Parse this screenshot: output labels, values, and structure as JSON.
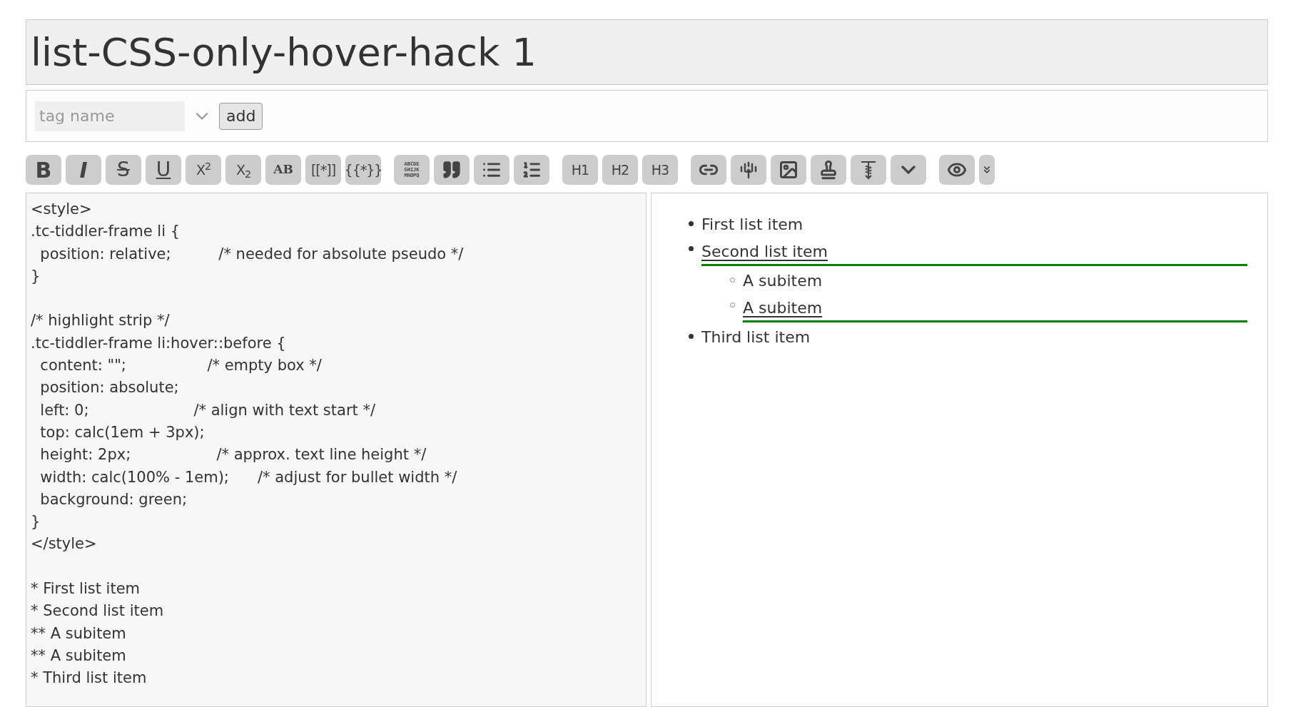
{
  "title": "list-CSS-only-hover-hack 1",
  "tag_input": {
    "placeholder": "tag name"
  },
  "add_button": "add",
  "toolbar": [
    [
      {
        "kind": "bold",
        "label": "B"
      },
      {
        "kind": "italic",
        "label": "I"
      },
      {
        "kind": "strike",
        "label": "S"
      },
      {
        "kind": "underline",
        "label": "U"
      },
      {
        "kind": "text",
        "label": "X$^{2}$"
      },
      {
        "kind": "text",
        "label": "X$_{2}$"
      },
      {
        "kind": "serif",
        "label": "AB"
      },
      {
        "kind": "text",
        "label": "[[*]]"
      },
      {
        "kind": "text",
        "label": "{{*}}"
      }
    ],
    [
      {
        "kind": "tiny",
        "label": "ABCDE GHIJK MNOPQ"
      },
      {
        "kind": "quote"
      },
      {
        "kind": "bullets"
      },
      {
        "kind": "numbers"
      }
    ],
    [
      {
        "kind": "text",
        "label": "H1"
      },
      {
        "kind": "text",
        "label": "H2"
      },
      {
        "kind": "text",
        "label": "H3"
      }
    ],
    [
      {
        "kind": "link"
      },
      {
        "kind": "transclude"
      },
      {
        "kind": "image"
      },
      {
        "kind": "stamp"
      },
      {
        "kind": "excise"
      },
      {
        "kind": "more"
      }
    ],
    [
      {
        "kind": "preview"
      },
      {
        "kind": "preview-menu"
      }
    ]
  ],
  "editor_blocks": [
    [
      "<style>",
      ".tc-tiddler-frame li {",
      "  position: relative;          /* needed for absolute pseudo */",
      "}"
    ],
    [
      "/* highlight strip */",
      ".tc-tiddler-frame li:hover::before {",
      "  content: \"\";                 /* empty box */",
      "  position: absolute;",
      "  left: 0;                      /* align with text start */",
      "  top: calc(1em + 3px);",
      "  height: 2px;                  /* approx. text line height */",
      "  width: calc(100% - 1em);      /* adjust for bullet width */",
      "  background: green;",
      "}",
      "</style>"
    ],
    [
      "* First list item",
      "* Second list item",
      "** A subitem",
      "** A subitem",
      "* Third list item"
    ]
  ],
  "preview_list": [
    {
      "text": "First list item",
      "highlighted": false
    },
    {
      "text": "Second list item",
      "highlighted": true,
      "children": [
        {
          "text": "A subitem",
          "highlighted": false
        },
        {
          "text": "A subitem",
          "highlighted": true
        }
      ]
    },
    {
      "text": "Third list item",
      "highlighted": false
    }
  ]
}
